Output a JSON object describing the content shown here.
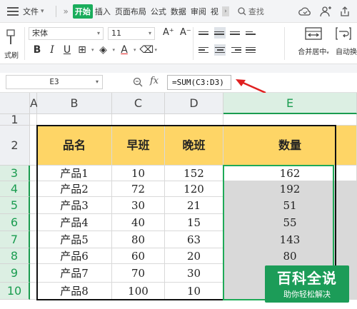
{
  "menubar": {
    "file_label": "文件",
    "tabs": [
      "开始",
      "插入",
      "页面布局",
      "公式",
      "数据",
      "审阅",
      "视"
    ],
    "active_tab": "开始",
    "search_label": "查找"
  },
  "ribbon": {
    "format_painter_label": "式刷",
    "font_name": "宋体",
    "font_size": "11",
    "merge_label": "合并居中",
    "wrap_label": "自动换"
  },
  "formula_bar": {
    "cell_ref": "E3",
    "fx_label": "fx",
    "formula": "=SUM(C3:D3)"
  },
  "sheet": {
    "columns": [
      "A",
      "B",
      "C",
      "D",
      "E"
    ],
    "selected_column": "E",
    "rows": [
      "1",
      "2",
      "3",
      "4",
      "5",
      "6",
      "7",
      "8",
      "9",
      "10"
    ],
    "header": [
      "品名",
      "早班",
      "晚班",
      "数量"
    ],
    "data": [
      [
        "产品1",
        "10",
        "152",
        "162"
      ],
      [
        "产品2",
        "72",
        "120",
        "192"
      ],
      [
        "产品3",
        "30",
        "21",
        "51"
      ],
      [
        "产品4",
        "40",
        "15",
        "55"
      ],
      [
        "产品5",
        "80",
        "63",
        "143"
      ],
      [
        "产品6",
        "60",
        "20",
        "80"
      ],
      [
        "产品7",
        "70",
        "30",
        ""
      ],
      [
        "产品8",
        "100",
        "10",
        ""
      ]
    ]
  },
  "watermark": {
    "title": "百科全说",
    "subtitle": "助你轻松解决"
  }
}
